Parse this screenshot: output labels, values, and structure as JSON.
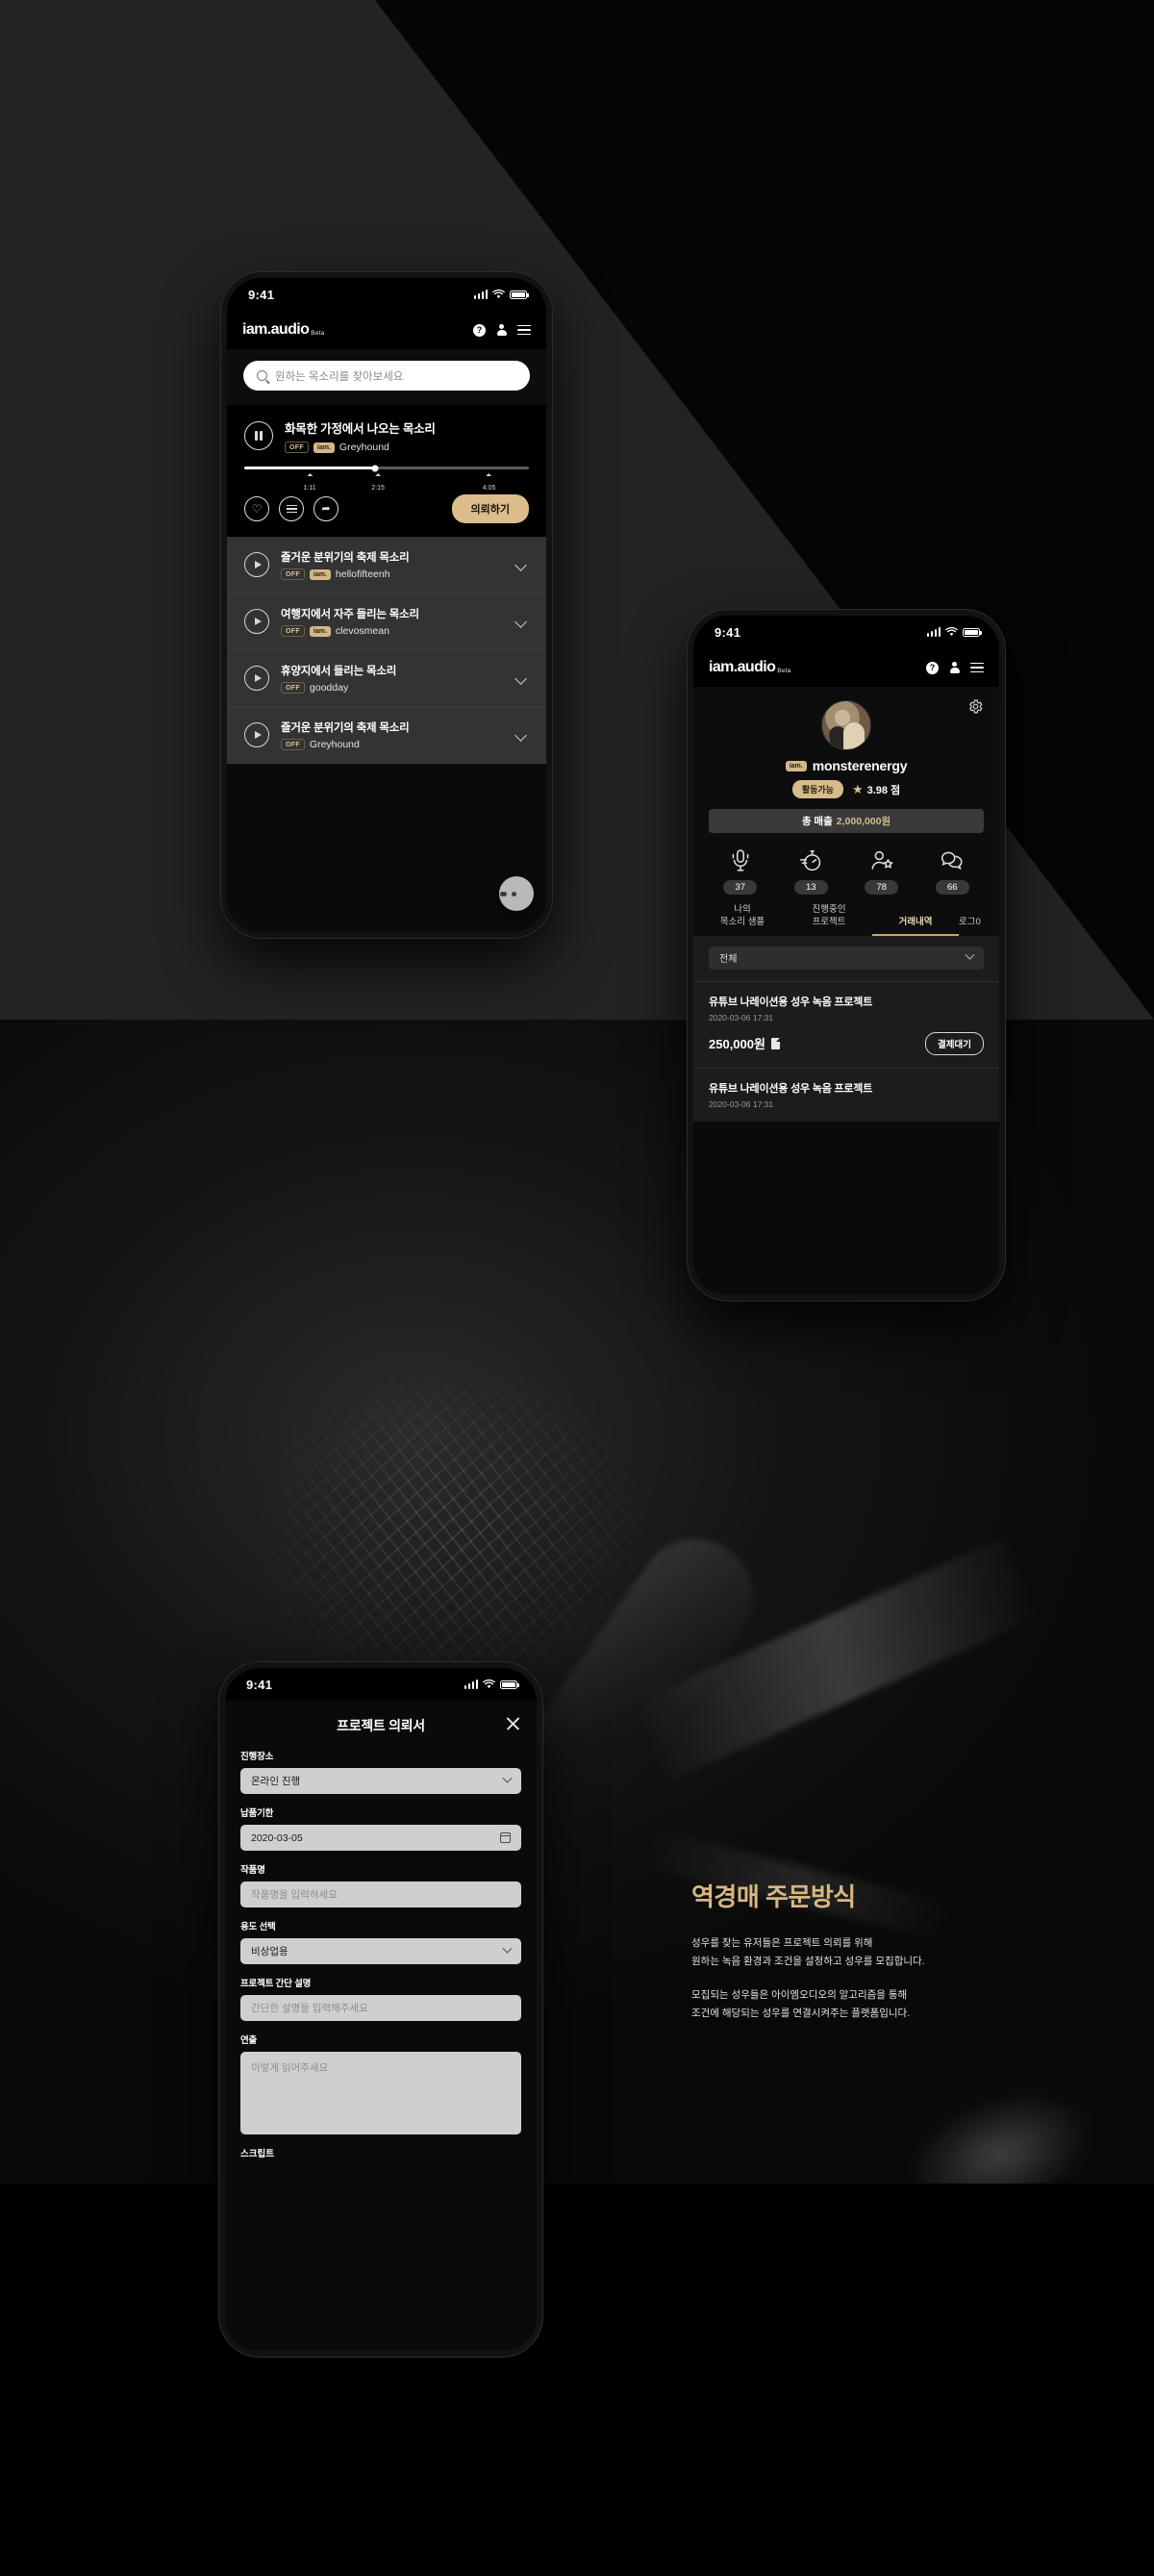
{
  "brand": {
    "logo": "iam.audio",
    "beta": "Beta"
  },
  "status_bar": {
    "time": "9:41"
  },
  "header_icons": {
    "help": "?",
    "help_name": "help-icon",
    "account_name": "account-icon",
    "menu_name": "hamburger-menu-icon"
  },
  "phone1": {
    "search": {
      "placeholder": "원하는 목소리를 찾아보세요"
    },
    "player": {
      "title": "화목한 가정에서 나오는 목소리",
      "tag_off": "OFF",
      "tag_iam": "iam.",
      "artist": "Greyhound",
      "marks": [
        "1:11",
        "2:15",
        "4:05"
      ],
      "progress_percent": 46,
      "cta_label": "의뢰하기"
    },
    "tracks": [
      {
        "title": "즐거운 분위기의 축제 목소리",
        "tag_off": "OFF",
        "tag_iam": "iam.",
        "artist": "hellofifteenh"
      },
      {
        "title": "여행지에서 자주 들리는 목소리",
        "tag_off": "OFF",
        "tag_iam": "iam.",
        "artist": "clevosmean"
      },
      {
        "title": "휴양지에서 들리는 목소리",
        "tag_off": "OFF",
        "tag_iam": "",
        "artist": "goodday"
      },
      {
        "title": "즐거운 분위기의 축제 목소리",
        "tag_off": "OFF",
        "tag_iam": "",
        "artist": "Greyhound"
      }
    ],
    "fab_name": "filter-fab"
  },
  "phone2": {
    "profile": {
      "username": "monsterenergy",
      "iam_badge": "iam.",
      "status_badge": "활동가능",
      "rating": "3.98 점",
      "revenue_label": "총 매출",
      "revenue_amount": "2,000,000원"
    },
    "stats": [
      {
        "icon": "microphone-icon",
        "value": "37"
      },
      {
        "icon": "stopwatch-icon",
        "value": "13"
      },
      {
        "icon": "person-star-icon",
        "value": "78"
      },
      {
        "icon": "chat-bubbles-icon",
        "value": "66"
      }
    ],
    "tabs": [
      {
        "label": "나의\n목소리 샘플",
        "active": false
      },
      {
        "label": "진행중인\n프로젝트",
        "active": false
      },
      {
        "label": "거래내역",
        "active": true
      },
      {
        "label": "로그0",
        "active": false
      }
    ],
    "filter": {
      "value": "전체"
    },
    "transactions": [
      {
        "title": "유튜브 나레이션용 성우 녹음 프로젝트",
        "date": "2020-03-06 17:31",
        "amount": "250,000원",
        "status": "결제대기"
      },
      {
        "title": "유튜브 나레이션용 성우 녹음 프로젝트",
        "date": "2020-03-06 17:31"
      }
    ]
  },
  "phone3": {
    "title": "프로젝트 의뢰서",
    "fields": [
      {
        "label": "진행장소",
        "value": "온라인 진행",
        "type": "select"
      },
      {
        "label": "납품기한",
        "value": "2020-03-05",
        "type": "date"
      },
      {
        "label": "작품명",
        "value": "작품명을 입력하세요",
        "type": "text-placeholder"
      },
      {
        "label": "용도 선택",
        "value": "비상업용",
        "type": "select"
      },
      {
        "label": "프로젝트 간단 설명",
        "value": "간단한 설명을 입력해주세요",
        "type": "text-placeholder"
      },
      {
        "label": "연출",
        "value": "이렇게 읽어주세요",
        "type": "textarea-placeholder"
      }
    ],
    "clipped_label": "스크립트"
  },
  "copy": {
    "heading": "역경매 주문방식",
    "p1_line1": "성우를 찾는 유저들은 프로젝트 의뢰를 위해",
    "p1_line2": "원하는 녹음 환경과 조건을 설정하고 성우를 모집합니다.",
    "p2_line1": "모집되는 성우들은 아이엠오디오의 알고리즘을 통해",
    "p2_line2": "조건에 해당되는 성우를 연결시켜주는 플랫폼입니다."
  },
  "colors": {
    "accent_gold": "#d6bb8c",
    "heading_gold": "#d9b781",
    "bg": "#232323"
  }
}
